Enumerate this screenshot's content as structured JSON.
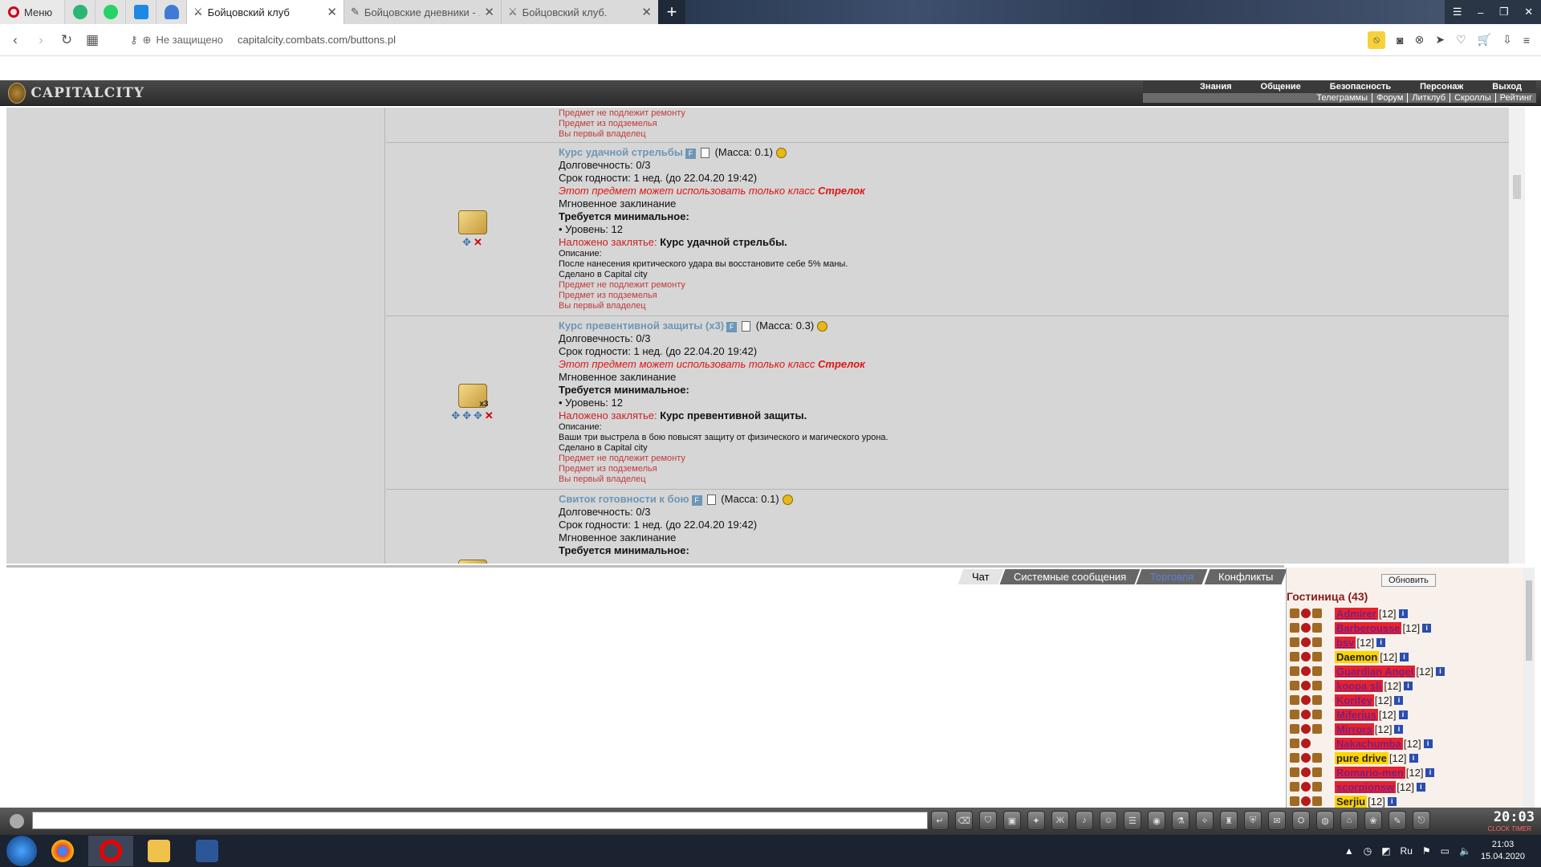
{
  "browser": {
    "menu_label": "Меню",
    "tabs": [
      {
        "label": "Бойцовский клуб",
        "active": true
      },
      {
        "label": "Бойцовские дневники - Л",
        "active": false
      },
      {
        "label": "Бойцовский клуб.",
        "active": false
      }
    ],
    "security_label": "Не защищено",
    "url": "capitalcity.combats.com/buttons.pl"
  },
  "game_header": {
    "logo": "CAPITALCITY",
    "menu_top": [
      "Знания",
      "Общение",
      "Безопасность",
      "Персонаж",
      "Выход"
    ],
    "menu_bottom": [
      "Телеграммы",
      "Форум",
      "Литклуб",
      "Скроллы",
      "Рейтинг"
    ]
  },
  "items_prev_tail": [
    "Предмет не подлежит ремонту",
    "Предмет из подземелья",
    "Вы первый владелец"
  ],
  "items": [
    {
      "name": "Курс удачной стрельбы",
      "mass": "(Масса: 0.1)",
      "durability": "Долговечность: 0/3",
      "expiry": "Срок годности: 1 нед. (до 22.04.20 19:42)",
      "class_warning_prefix": "Этот предмет может использовать только класс",
      "class_name": "Стрелок",
      "type": "Мгновенное заклинание",
      "req_title": "Требуется минимальное:",
      "req_level": "• Уровень: 12",
      "spell_prefix": "Наложено заклятье:",
      "spell_name": "Курс удачной стрельбы.",
      "desc_label": "Описание:",
      "desc": "После нанесения критического удара вы восстановите себе 5% маны.",
      "made_in": "Сделано в Capital city",
      "flags": [
        "Предмет не подлежит ремонту",
        "Предмет из подземелья",
        "Вы первый владелец"
      ],
      "count": ""
    },
    {
      "name": "Курс превентивной защиты (x3)",
      "mass": "(Масса: 0.3)",
      "durability": "Долговечность: 0/3",
      "expiry": "Срок годности: 1 нед. (до 22.04.20 19:42)",
      "class_warning_prefix": "Этот предмет может использовать только класс",
      "class_name": "Стрелок",
      "type": "Мгновенное заклинание",
      "req_title": "Требуется минимальное:",
      "req_level": "• Уровень: 12",
      "spell_prefix": "Наложено заклятье:",
      "spell_name": "Курс превентивной защиты.",
      "desc_label": "Описание:",
      "desc": "Ваши три выстрела в бою повысят защиту от физического и магического урона.",
      "made_in": "Сделано в Capital city",
      "flags": [
        "Предмет не подлежит ремонту",
        "Предмет из подземелья",
        "Вы первый владелец"
      ],
      "count": "x3"
    },
    {
      "name": "Свиток готовности к бою",
      "mass": "(Масса: 0.1)",
      "durability": "Долговечность: 0/3",
      "expiry": "Срок годности: 1 нед. (до 22.04.20 19:42)",
      "type": "Мгновенное заклинание",
      "req_title": "Требуется минимальное:"
    }
  ],
  "chat": {
    "tabs": [
      "Чат",
      "Системные сообщения",
      "Торговля",
      "Конфликты"
    ]
  },
  "online": {
    "refresh_label": "Обновить",
    "location": "Гостиница (43)",
    "users": [
      {
        "name": "Admirer",
        "level": "[12]",
        "yellow": false
      },
      {
        "name": "Barberousse",
        "level": "[12]",
        "yellow": false
      },
      {
        "name": "bsv",
        "level": "[12]",
        "yellow": false
      },
      {
        "name": "Daemon",
        "level": "[12]",
        "yellow": true
      },
      {
        "name": "Guardian Angel",
        "level": "[12]",
        "yellow": false
      },
      {
        "name": "koopa sli",
        "level": "[12]",
        "yellow": false
      },
      {
        "name": "Korifey",
        "level": "[12]",
        "yellow": false
      },
      {
        "name": "Miferius",
        "level": "[12]",
        "yellow": false
      },
      {
        "name": "Mirrors",
        "level": "[12]",
        "yellow": false
      },
      {
        "name": "Nakachumba",
        "level": "[12]",
        "yellow": false
      },
      {
        "name": "pure drive",
        "level": "[12]",
        "yellow": true
      },
      {
        "name": "Romario-men",
        "level": "[12]",
        "yellow": false
      },
      {
        "name": "scorpionsw",
        "level": "[12]",
        "yellow": false
      },
      {
        "name": "Serjiu",
        "level": "[12]",
        "yellow": false
      }
    ]
  },
  "bottombar": {
    "clock": "20:03",
    "clock_label": "CLOCK TIMER"
  },
  "taskbar": {
    "lang": "Ru",
    "time": "21:03",
    "date": "15.04.2020"
  }
}
